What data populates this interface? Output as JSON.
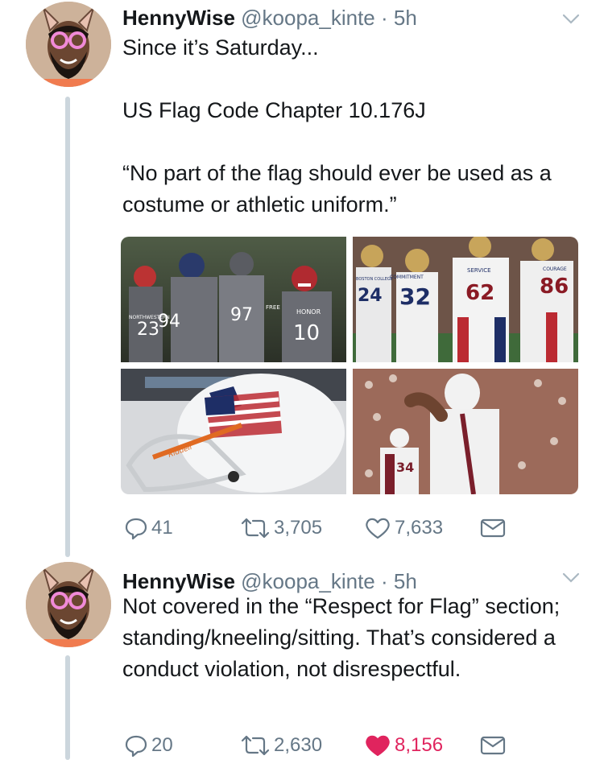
{
  "colors": {
    "text": "#14171a",
    "muted": "#657786",
    "thread_line": "#ccd6dd",
    "like_active": "#e0245e"
  },
  "tweets": [
    {
      "display_name": "HennyWise",
      "handle": "@koopa_kinte",
      "separator": "·",
      "time": "5h",
      "text": "Since it’s Saturday...\n\nUS Flag Code Chapter 10.176J\n\n“No part of the flag should ever be used as a costume or athletic uniform.”",
      "media": [
        {
          "alt": "Northwestern players in flag-patterned uniforms",
          "numbers": [
            "23",
            "94",
            "97",
            "10"
          ],
          "labels": [
            "NORTHWESTERN",
            "FREE",
            "HONOR"
          ]
        },
        {
          "alt": "Boston College players in flag uniforms",
          "numbers": [
            "24",
            "32",
            "62",
            "86"
          ],
          "labels": [
            "BOSTON COLLEGE",
            "COMMITMENT",
            "SERVICE",
            "COURAGE"
          ]
        },
        {
          "alt": "UNC helmet with flag-pattern logo",
          "numbers": [],
          "labels": [
            "Riddell"
          ]
        },
        {
          "alt": "Virginia Tech player in stars-and-stripes uniform",
          "numbers": [
            "34"
          ],
          "labels": []
        }
      ],
      "actions": {
        "reply": "41",
        "retweet": "3,705",
        "like": "7,633",
        "liked": false
      }
    },
    {
      "display_name": "HennyWise",
      "handle": "@koopa_kinte",
      "separator": "·",
      "time": "5h",
      "text": "Not covered in the “Respect for Flag” section; standing/kneeling/sitting. That’s considered a conduct violation, not disrespectful.",
      "media": [],
      "actions": {
        "reply": "20",
        "retweet": "2,630",
        "like": "8,156",
        "liked": true
      }
    }
  ]
}
